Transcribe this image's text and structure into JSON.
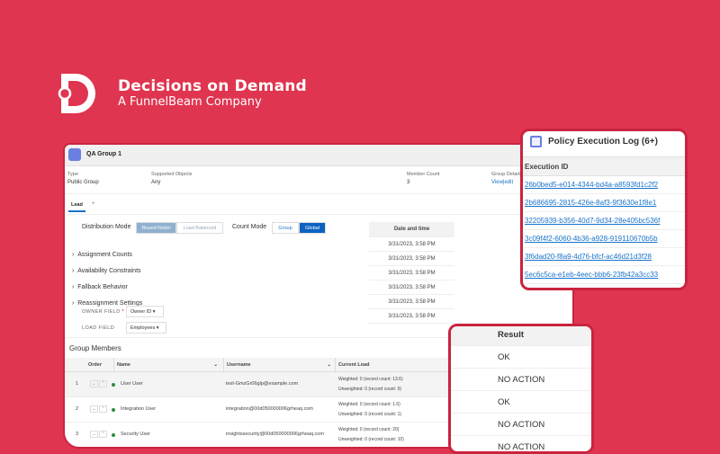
{
  "brand": {
    "title": "Decisions on Demand",
    "subtitle": "A FunnelBeam Company",
    "color": "#e03550"
  },
  "group": {
    "title": "QA Group 1",
    "type_label": "Type",
    "type_value": "Public Group",
    "objects_label": "Supported Objects",
    "objects_value": "Any",
    "member_count_label": "Member Count",
    "member_count_value": "3",
    "details_label": "Group Details",
    "details_value": "View|edit"
  },
  "tabs": [
    {
      "label": "Lead"
    },
    {
      "label": "+"
    }
  ],
  "distribution": {
    "label": "Distribution Mode",
    "options": [
      "Round Robin",
      "Load Balanced"
    ],
    "selected": "Round Robin"
  },
  "count_mode": {
    "label": "Count Mode",
    "options": [
      "Group",
      "Global"
    ],
    "selected": "Global"
  },
  "sections": [
    "Assignment Counts",
    "Availability Constraints",
    "Fallback Behavior",
    "Reassignment Settings"
  ],
  "owner_field": {
    "label": "OWNER FIELD",
    "required": "*",
    "value": "Owner ID"
  },
  "load_field": {
    "label": "LOAD FIELD",
    "value": "Employees"
  },
  "date_table": {
    "header": "Date and time",
    "rows": [
      "3/31/2023, 3:58 PM",
      "3/31/2023, 3:58 PM",
      "3/31/2023, 3:58 PM",
      "3/31/2023, 3:58 PM",
      "3/31/2023, 3:58 PM",
      "3/31/2023, 3:58 PM"
    ]
  },
  "members": {
    "title": "Group Members",
    "columns": [
      "Order",
      "Name",
      "Username",
      "Current Load"
    ],
    "rows": [
      {
        "order": "1",
        "name": "User User",
        "username": "test-GmzGr06glp@example.com",
        "weighted": "Weighted: 0 (record count: 13.6)",
        "unweighted": "Unweighted: 0 (record count: 9)"
      },
      {
        "order": "2",
        "name": "Integration User",
        "username": "integration@00d050000006grheaq.com",
        "weighted": "Weighted: 0 (record count: 1.6)",
        "unweighted": "Unweighted: 0 (record count: 1)"
      },
      {
        "order": "3",
        "name": "Security User",
        "username": "insightssecurity@00d050000006grheaq.com",
        "weighted": "Weighted: 0 (record count: 20)",
        "unweighted": "Unweighted: 0 (record count: 10)"
      }
    ]
  },
  "policy": {
    "title": "Policy Execution Log (6+)",
    "column": "Execution ID",
    "ids": [
      "26b0bed5-e014-4344-bd4a-a8593fd1c2f2",
      "2b686695-2815-426e-8af3-9f3630e1f8e1",
      "32205939-b356-40d7-9d34-28e405bc536f",
      "3c09f4f2-6060-4b36-a928-919110670b5b",
      "3f6dad20-f8a9-4d76-bfcf-ac46d21d3f28",
      "5ec6c5ca-e1eb-4eec-bbb6-23fb42a3cc33"
    ]
  },
  "result": {
    "header": "Result",
    "rows": [
      "OK",
      "NO ACTION",
      "OK",
      "NO ACTION",
      "NO ACTION"
    ]
  }
}
